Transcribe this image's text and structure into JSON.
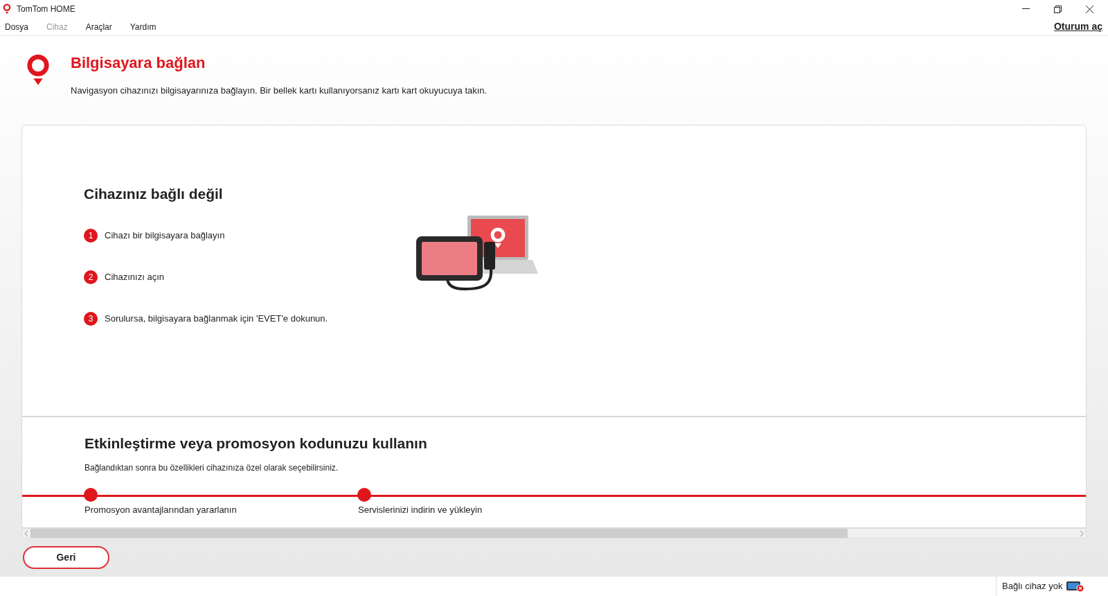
{
  "window": {
    "title": "TomTom HOME"
  },
  "menu": [
    {
      "label": "Dosya",
      "disabled": false
    },
    {
      "label": "Cihaz",
      "disabled": true
    },
    {
      "label": "Araçlar",
      "disabled": false
    },
    {
      "label": "Yardım",
      "disabled": false
    }
  ],
  "sign_in": "Oturum aç",
  "header": {
    "title": "Bilgisayara bağlan",
    "subtitle": "Navigasyon cihazınızı bilgisayarınıza bağlayın. Bir bellek kartı kullanıyorsanız kartı kart okuyucuya takın."
  },
  "status_card": {
    "title": "Cihazınız bağlı değil",
    "steps": [
      {
        "number": "1",
        "text": "Cihazı bir bilgisayara bağlayın"
      },
      {
        "number": "2",
        "text": "Cihazınızı açın"
      },
      {
        "number": "3",
        "text": "Sorulursa, bilgisayara bağlanmak için 'EVET'e dokunun."
      }
    ]
  },
  "promo": {
    "title": "Etkinleştirme veya promosyon kodunuzu kullanın",
    "subtitle": "Bağlandıktan sonra bu özellikleri cihazınıza özel olarak seçebilirsiniz.",
    "milestones": [
      "Promosyon avantajlarından yararlanın",
      "Servislerinizi indirin ve yükleyin"
    ]
  },
  "back_button": "Geri",
  "status_bar": {
    "text": "Bağlı cihaz yok"
  }
}
